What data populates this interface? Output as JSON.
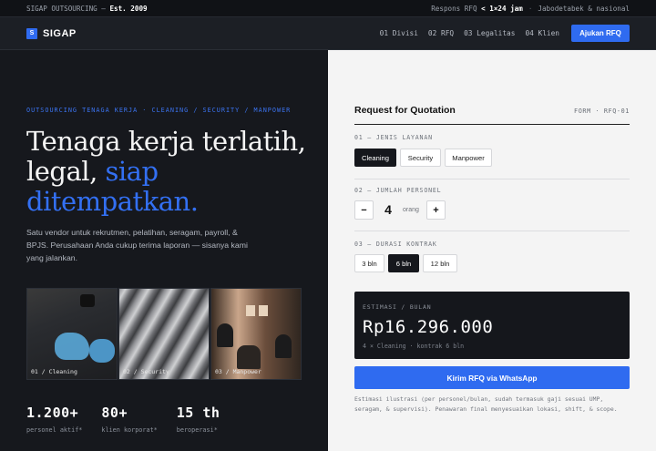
{
  "topbar": {
    "brand_line": "SIGAP OUTSOURCING — ",
    "est": "Est. 2009",
    "response_prefix": "Respons RFQ ",
    "response_time": "< 1×24 jam",
    "separator": "·",
    "coverage": "Jabodetabek & nasional"
  },
  "nav": {
    "logo_letter": "S",
    "logo_text": "SIGAP",
    "links": [
      "01 Divisi",
      "02 RFQ",
      "03 Legalitas",
      "04 Klien"
    ],
    "cta": "Ajukan RFQ"
  },
  "hero": {
    "eyebrow": "OUTSOURCING TENAGA KERJA · CLEANING / SECURITY / MANPOWER",
    "headline_line1": "Tenaga kerja terlatih,",
    "headline_line2": "legal, ",
    "headline_accent1": "siap",
    "headline_accent2": "ditempatkan.",
    "lead": "Satu vendor untuk rekrutmen, pelatihan, seragam, payroll, & BPJS. Perusahaan Anda cukup terima laporan — sisanya kami yang jalankan.",
    "gallery": [
      {
        "caption": "01 / Cleaning"
      },
      {
        "caption": "02 / Security"
      },
      {
        "caption": "03 / Manpower"
      }
    ],
    "stats": [
      {
        "value": "1.200+",
        "label": "personel aktif*"
      },
      {
        "value": "80+",
        "label": "klien korporat*"
      },
      {
        "value": "15 th",
        "label": "beroperasi*"
      }
    ]
  },
  "form": {
    "title": "Request for Quotation",
    "code": "FORM · RFQ-01",
    "service_label": "01 — JENIS LAYANAN",
    "services": [
      "Cleaning",
      "Security",
      "Manpower"
    ],
    "service_selected": "Cleaning",
    "personnel_label": "02 — JUMLAH PERSONEL",
    "minus": "−",
    "personnel_value": "4",
    "personnel_unit": "orang",
    "plus": "+",
    "duration_label": "03 — DURASI KONTRAK",
    "durations": [
      "3 bln",
      "6 bln",
      "12 bln"
    ],
    "duration_selected": "6 bln",
    "estimate_label": "ESTIMASI / BULAN",
    "estimate_value": "Rp16.296.000",
    "estimate_note": "4 × Cleaning · kontrak 6 bln",
    "submit": "Kirim RFQ via WhatsApp",
    "disclaimer": "Estimasi ilustrasi (per personel/bulan, sudah termasuk gaji sesuai UMP, seragam, & supervisi). Penawaran final menyesuaikan lokasi, shift, & scope."
  },
  "colors": {
    "accent": "#2f6bf0",
    "dark": "#15171c",
    "light_panel": "#f4f4f4"
  }
}
